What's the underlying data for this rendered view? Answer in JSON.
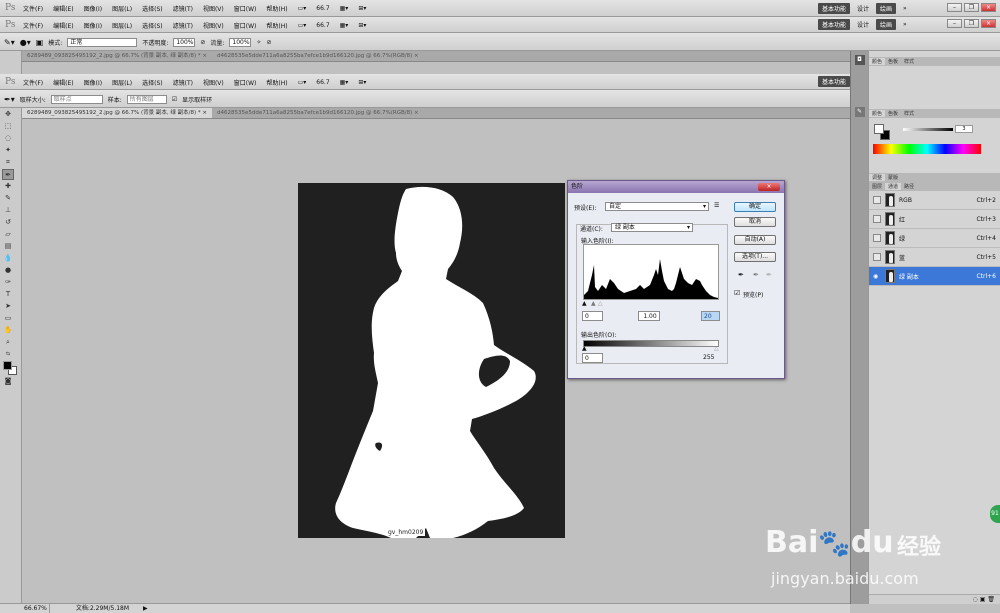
{
  "app": {
    "logo": "Ps"
  },
  "menu": [
    "文件(F)",
    "编辑(E)",
    "图像(I)",
    "图层(L)",
    "选择(S)",
    "滤镜(T)",
    "视图(V)",
    "窗口(W)",
    "帮助(H)"
  ],
  "zoom_display": "66.7",
  "workspace": {
    "items": [
      "基本功能",
      "设计",
      "绘画"
    ],
    "more": "»"
  },
  "options_brush": {
    "mode_label": "模式:",
    "mode_value": "正常",
    "opacity_label": "不透明度:",
    "opacity_value": "100%",
    "flow_label": "流量:",
    "flow_value": "100%"
  },
  "options_eyedropper": {
    "size_label": "取样大小:",
    "size_value": "取样点",
    "sample_label": "样本:",
    "sample_value": "所有图层",
    "show_ring": "显示取样环"
  },
  "doc_tabs": {
    "tab1": "6289489_093825495192_2.jpg @ 66.7% (背景 副本, 绿 副本/8) * ×",
    "tab2": "d4628535e5dde711a6a8255ba7efce1b9d166120.jpg @ 66.7%(RGB/8) ×",
    "tab1_short": "6289489_093825495192_2.jpg @ 66.7%...",
    "tab2_short": "d4628535e5dde711a6a8255ba7efce1b9d166120.jpg @ 66.7%(RGB/8) ×"
  },
  "canvas": {
    "watermark": "gv_hm0209"
  },
  "levels": {
    "title": "色阶",
    "preset_label": "预设(E):",
    "preset_value": "自定",
    "channel_label": "通道(C):",
    "channel_value": "绿 副本",
    "input_label": "输入色阶(I):",
    "output_label": "输出色阶(O):",
    "input_black": "0",
    "input_gamma": "1.00",
    "input_white": "20",
    "output_black": "0",
    "output_white": "255",
    "btn_ok": "确定",
    "btn_cancel": "取消",
    "btn_auto": "自动(A)",
    "btn_options": "选项(T)...",
    "preview": "预览(P)"
  },
  "panels": {
    "color_tabs": [
      "颜色",
      "色板",
      "样式"
    ],
    "color_tabs2": [
      "颜色",
      "色板",
      "样式"
    ],
    "slider_value": "3",
    "adj_tabs": [
      "调整",
      "蒙版"
    ],
    "layer_tabs": [
      "图层",
      "通道",
      "路径"
    ],
    "channels": [
      {
        "name": "RGB",
        "shortcut": "Ctrl+2"
      },
      {
        "name": "红",
        "shortcut": "Ctrl+3"
      },
      {
        "name": "绿",
        "shortcut": "Ctrl+4"
      },
      {
        "name": "蓝",
        "shortcut": "Ctrl+5"
      },
      {
        "name": "绿 副本",
        "shortcut": "Ctrl+6"
      }
    ]
  },
  "status": {
    "zoom": "66.67%",
    "doc": "文档:2.29M/5.18M"
  },
  "baidu": {
    "brand": "Bai",
    "brand2": "du",
    "jingyan": "经验",
    "url": "jingyan.baidu.com"
  },
  "side_badge": "91"
}
